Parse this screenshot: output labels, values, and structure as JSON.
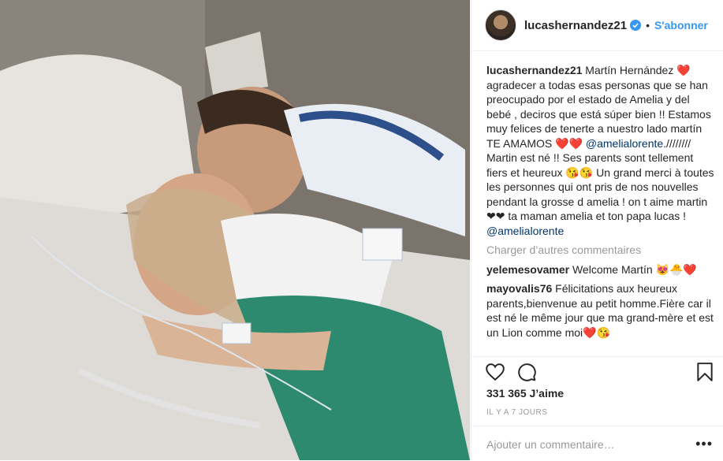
{
  "post": {
    "username": "lucashernandez21",
    "dot": "•",
    "follow_label": "S'abonner"
  },
  "caption": {
    "user": "lucashernandez21",
    "text_1": "Martín Hernández ",
    "heart_1": "❤️",
    "text_2": " agradecer a todas esas personas que se han preocupado por el estado de Amelia y del bebé , deciros que está súper bien !! Estamos muy felices de tenerte a nuestro lado martín TE AMAMOS ",
    "heart_2": "❤️❤️",
    "mention_1": "@amelialorente",
    "text_3": ".//////// Martin est né !! Ses parents sont tellement fiers et heureux ",
    "emoji_1": "😘😘",
    "text_4": " Un grand merci à toutes les personnes qui ont pris de nos nouvelles pendant la grosse d amelia ! on t aime martin ❤❤ ta maman amelia et ton papa lucas ! ",
    "mention_2": "@amelialorente"
  },
  "load_more": "Charger d’autres commentaires",
  "comments": [
    {
      "user": "yelemesovamer",
      "text": " Welcome Martín ",
      "emoji": "😻🐣❤️"
    },
    {
      "user": "mayovalis76",
      "text": " Félicitations aux heureux parents,bienvenue au petit homme.Fière car il est né le même jour que ma grand-mère et est un Lion comme moi",
      "emoji": "❤️😘"
    }
  ],
  "likes": "331 365 J’aime",
  "time": "IL Y A 7 JOURS",
  "add_comment_placeholder": "Ajouter un commentaire…",
  "more_label": "•••",
  "colors": {
    "follow": "#3897f0",
    "mention": "#003569",
    "muted": "#999999",
    "verified": "#3897f0"
  }
}
